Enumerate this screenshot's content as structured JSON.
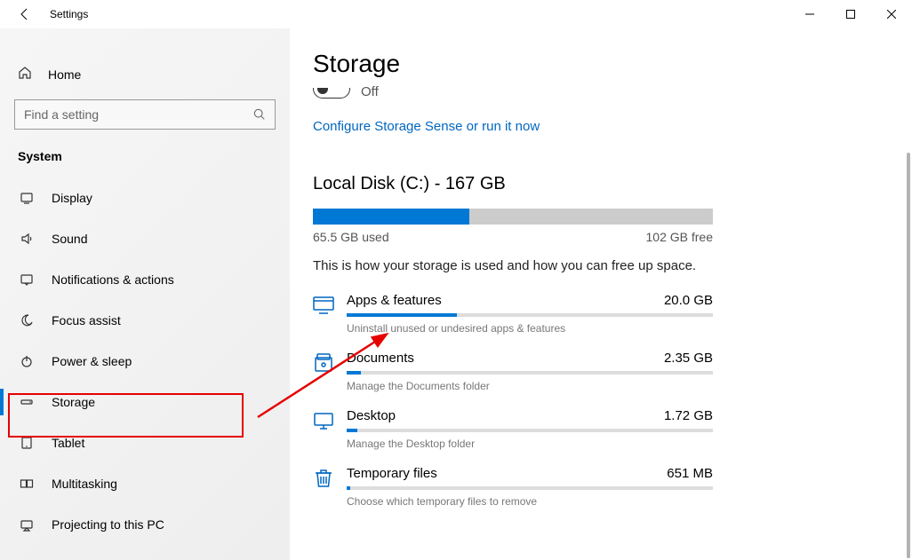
{
  "titlebar": {
    "title": "Settings"
  },
  "sidebar": {
    "home": "Home",
    "search_placeholder": "Find a setting",
    "group": "System",
    "items": [
      {
        "label": "Display",
        "icon": "display"
      },
      {
        "label": "Sound",
        "icon": "sound"
      },
      {
        "label": "Notifications & actions",
        "icon": "notifications"
      },
      {
        "label": "Focus assist",
        "icon": "moon"
      },
      {
        "label": "Power & sleep",
        "icon": "power"
      },
      {
        "label": "Storage",
        "icon": "storage",
        "active": true
      },
      {
        "label": "Tablet",
        "icon": "tablet"
      },
      {
        "label": "Multitasking",
        "icon": "multitasking"
      },
      {
        "label": "Projecting to this PC",
        "icon": "projecting"
      }
    ]
  },
  "page": {
    "title": "Storage",
    "sense": {
      "state": "Off",
      "link": "Configure Storage Sense or run it now"
    },
    "disk": {
      "title": "Local Disk (C:) - 167 GB",
      "used_label": "65.5 GB used",
      "free_label": "102 GB free",
      "used_pct": 39,
      "description": "This is how your storage is used and how you can free up space.",
      "categories": [
        {
          "name": "Apps & features",
          "size": "20.0 GB",
          "hint": "Uninstall unused or undesired apps & features",
          "fill_pct": 30,
          "icon": "apps"
        },
        {
          "name": "Documents",
          "size": "2.35 GB",
          "hint": "Manage the Documents folder",
          "fill_pct": 4,
          "icon": "documents"
        },
        {
          "name": "Desktop",
          "size": "1.72 GB",
          "hint": "Manage the Desktop folder",
          "fill_pct": 3,
          "icon": "desktop"
        },
        {
          "name": "Temporary files",
          "size": "651 MB",
          "hint": "Choose which temporary files to remove",
          "fill_pct": 1,
          "icon": "trash"
        }
      ]
    }
  }
}
